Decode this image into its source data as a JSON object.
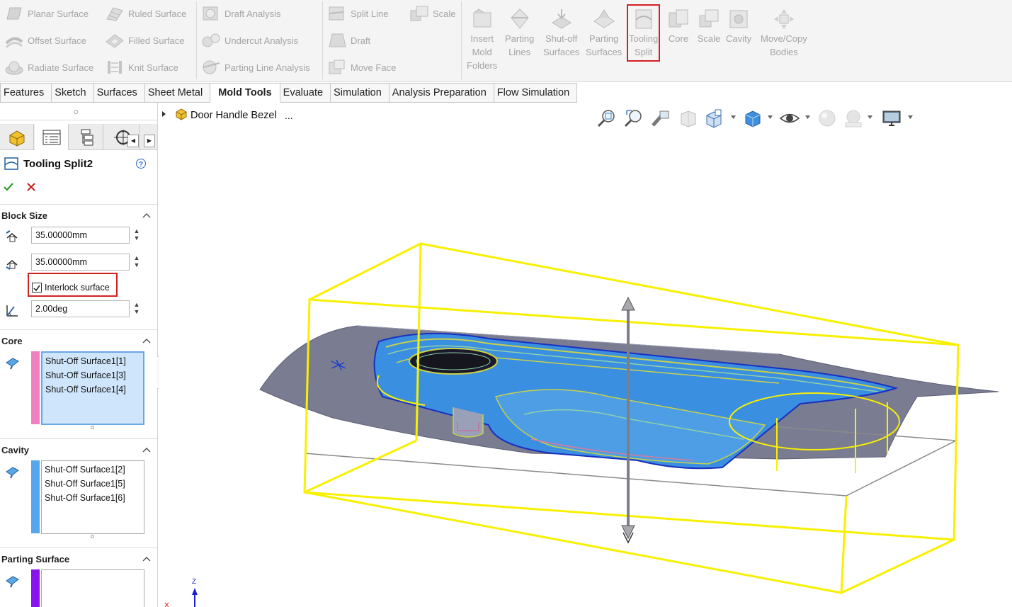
{
  "ribbon": {
    "col1": [
      "Planar Surface",
      "Offset Surface",
      "Radiate Surface"
    ],
    "col2": [
      "Ruled Surface",
      "Filled Surface",
      "Knit Surface"
    ],
    "col3": [
      "Draft Analysis",
      "Undercut Analysis",
      "Parting Line Analysis"
    ],
    "col4": [
      "Split Line",
      "Draft",
      "Move Face"
    ],
    "col5": [
      "Scale"
    ],
    "large": [
      {
        "label": "Insert\nMold\nFolders",
        "icon": "mold-folder-icon"
      },
      {
        "label": "Parting\nLines",
        "icon": "parting-lines-icon"
      },
      {
        "label": "Shut-off\nSurfaces",
        "icon": "shutoff-surfaces-icon"
      },
      {
        "label": "Parting\nSurfaces",
        "icon": "parting-surfaces-icon"
      },
      {
        "label": "Tooling\nSplit",
        "icon": "tooling-split-icon",
        "highlighted": true
      },
      {
        "label": "Core",
        "icon": "core-icon"
      },
      {
        "label": "Scale",
        "icon": "scale-icon"
      },
      {
        "label": "Cavity",
        "icon": "cavity-icon"
      },
      {
        "label": "Move/Copy\nBodies",
        "icon": "move-copy-icon"
      }
    ]
  },
  "tabs": [
    "Features",
    "Sketch",
    "Surfaces",
    "Sheet Metal",
    "Mold Tools",
    "Evaluate",
    "Simulation",
    "Analysis Preparation",
    "Flow Simulation"
  ],
  "active_tab": "Mold Tools",
  "panel": {
    "title": "Tooling Split2",
    "block_size": {
      "label": "Block Size",
      "depth1": "35.00000mm",
      "depth2": "35.00000mm",
      "interlock_label": "Interlock surface",
      "interlock_checked": true,
      "angle": "2.00deg"
    },
    "core": {
      "label": "Core",
      "items": [
        "Shut-Off Surface1[1]",
        "Shut-Off Surface1[3]",
        "Shut-Off Surface1[4]"
      ]
    },
    "cavity": {
      "label": "Cavity",
      "items": [
        "Shut-Off Surface1[2]",
        "Shut-Off Surface1[5]",
        "Shut-Off Surface1[6]"
      ]
    },
    "parting": {
      "label": "Parting Surface",
      "items": []
    }
  },
  "viewport": {
    "tree_item": "Door Handle Bezel",
    "tree_ellipsis": "...",
    "triad_z": "Z"
  },
  "colors": {
    "highlight_red": "#d32020",
    "core_color": "#f080c0",
    "cavity_color": "#55a6ee",
    "parting_color": "#8a12f0",
    "block_outline": "#f8f000",
    "part_blue": "#3a8fe0",
    "surface_gray": "#7a7d92"
  }
}
